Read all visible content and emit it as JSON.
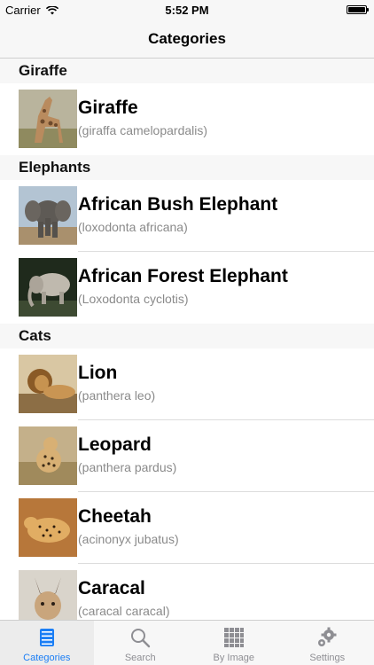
{
  "status_bar": {
    "carrier": "Carrier",
    "time": "5:52 PM"
  },
  "nav": {
    "title": "Categories"
  },
  "sections": [
    {
      "title": "Giraffe",
      "items": [
        {
          "name": "Giraffe",
          "sci": "(giraffa camelopardalis)"
        }
      ]
    },
    {
      "title": "Elephants",
      "items": [
        {
          "name": "African Bush Elephant",
          "sci": "(loxodonta africana)"
        },
        {
          "name": "African Forest Elephant",
          "sci": "(Loxodonta cyclotis)"
        }
      ]
    },
    {
      "title": "Cats",
      "items": [
        {
          "name": "Lion",
          "sci": "(panthera leo)"
        },
        {
          "name": "Leopard",
          "sci": "(panthera pardus)"
        },
        {
          "name": "Cheetah",
          "sci": "(acinonyx jubatus)"
        },
        {
          "name": "Caracal",
          "sci": "(caracal caracal)"
        }
      ]
    }
  ],
  "tabs": [
    {
      "label": "Categories",
      "icon": "categories-icon",
      "active": true
    },
    {
      "label": "Search",
      "icon": "search-icon",
      "active": false
    },
    {
      "label": "By Image",
      "icon": "grid-icon",
      "active": false
    },
    {
      "label": "Settings",
      "icon": "gear-icon",
      "active": false
    }
  ],
  "colors": {
    "accent": "#1b7ef5",
    "inactive": "#8e8e93",
    "section_bg": "#f7f7f7"
  }
}
